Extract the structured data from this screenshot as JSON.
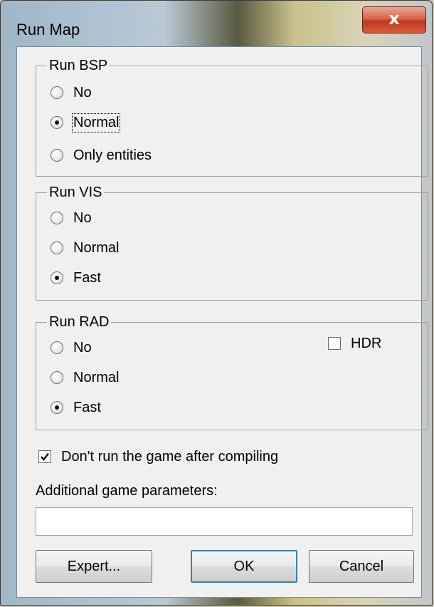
{
  "window": {
    "title": "Run Map",
    "close_label": "x"
  },
  "bsp": {
    "label": "Run BSP",
    "options": [
      {
        "label": "No",
        "selected": false
      },
      {
        "label": "Normal",
        "selected": true
      },
      {
        "label": "Only entities",
        "selected": false
      }
    ]
  },
  "vis": {
    "label": "Run VIS",
    "options": [
      {
        "label": "No",
        "selected": false
      },
      {
        "label": "Normal",
        "selected": false
      },
      {
        "label": "Fast",
        "selected": true
      }
    ]
  },
  "rad": {
    "label": "Run RAD",
    "options": [
      {
        "label": "No",
        "selected": false
      },
      {
        "label": "Normal",
        "selected": false
      },
      {
        "label": "Fast",
        "selected": true
      }
    ],
    "hdr_label": "HDR",
    "hdr_checked": false
  },
  "dont_run_label": "Don't run the game after compiling",
  "dont_run_checked": true,
  "params_label": "Additional game parameters:",
  "params_value": "",
  "buttons": {
    "expert": "Expert...",
    "ok": "OK",
    "cancel": "Cancel"
  }
}
